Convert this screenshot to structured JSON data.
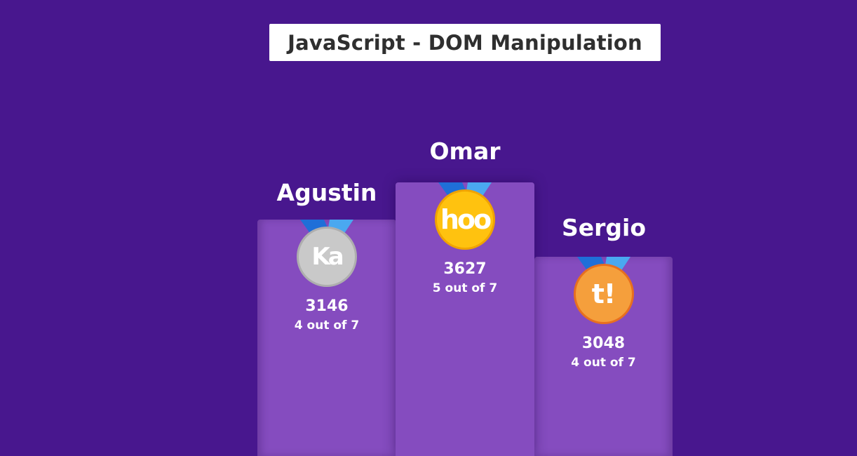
{
  "title": "JavaScript - DOM Manipulation",
  "colors": {
    "background": "#48178e",
    "podium": "#854cbf",
    "silver": "#c9c9c9",
    "gold": "#ffc20f",
    "bronze": "#f59f3c"
  },
  "leaderboard": [
    {
      "place": "second",
      "name": "Agustin",
      "score": "3146",
      "progress": "4 out of 7",
      "badge_text": "Ka",
      "medal": "silver"
    },
    {
      "place": "first",
      "name": "Omar",
      "score": "3627",
      "progress": "5 out of 7",
      "badge_text": "hoo",
      "medal": "gold"
    },
    {
      "place": "third",
      "name": "Sergio",
      "score": "3048",
      "progress": "4 out of 7",
      "badge_text": "t!",
      "medal": "bronze"
    }
  ]
}
